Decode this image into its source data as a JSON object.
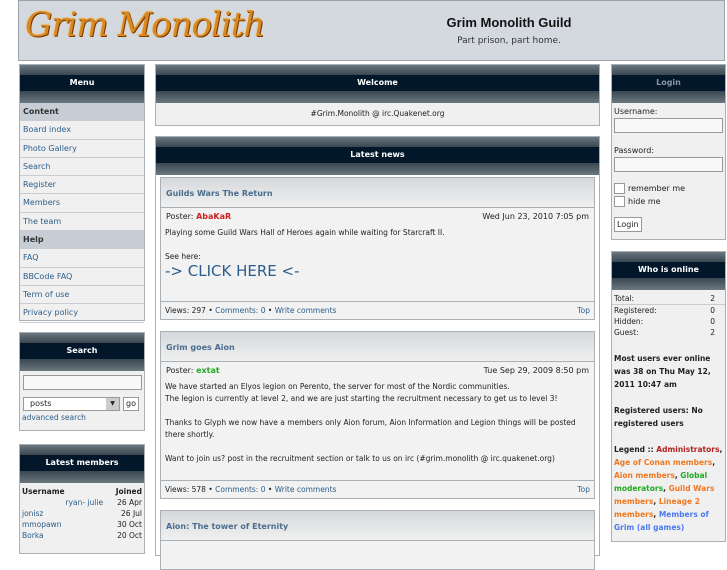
{
  "header": {
    "logo_text": "Grim Monolith",
    "title": "Grim Monolith Guild",
    "description": "Part prison, part home."
  },
  "menu": {
    "title": "Menu",
    "items": [
      {
        "label": "Content",
        "type": "heading"
      },
      {
        "label": "Board index"
      },
      {
        "label": "Photo Gallery"
      },
      {
        "label": "Search"
      },
      {
        "label": "Register"
      },
      {
        "label": "Members"
      },
      {
        "label": "The team"
      },
      {
        "label": "Help",
        "type": "heading"
      },
      {
        "label": "FAQ"
      },
      {
        "label": "BBCode FAQ"
      },
      {
        "label": "Term of use"
      },
      {
        "label": "Privacy policy"
      }
    ]
  },
  "search": {
    "title": "Search",
    "query": "",
    "scope": "posts",
    "go": "go",
    "advanced": "advanced search"
  },
  "latest_members": {
    "title": "Latest members",
    "headers": [
      "Username",
      "Joined"
    ],
    "rows": [
      [
        "ryan- julie",
        "26 Apr"
      ],
      [
        "jonisz",
        "26 Jul"
      ],
      [
        "mmopawn",
        "30 Oct"
      ],
      [
        "Borka",
        "20 Oct"
      ]
    ]
  },
  "welcome": {
    "title": "Welcome",
    "text": "#Grim.Monolith @ irc.Quakenet.org"
  },
  "news": {
    "title": "Latest news",
    "posts": [
      {
        "title": "Guilds Wars The Return",
        "poster_label": "Poster:",
        "poster": "AbaKaR",
        "poster_color": "#cc2222",
        "date": "Wed Jun 23, 2010 7:05 pm",
        "body": [
          "Playing some Guild Wars Hall of Heroes again while waiting for Starcraft II.",
          "",
          "See here:"
        ],
        "big_link": "-> CLICK HERE <-",
        "views": "Views: 297",
        "comments": "Comments: 0",
        "write": "Write comments",
        "top": "Top"
      },
      {
        "title": "Grim goes Aion",
        "poster_label": "Poster:",
        "poster": "extat",
        "poster_color": "#22aa22",
        "date": "Tue Sep 29, 2009 8:50 pm",
        "body": [
          "We have started an Elyos legion on Perento, the server for most of the Nordic communities.",
          "The legion is currently at level 2, and we are just starting the recruitment necessary to get us to level 3!",
          "",
          "Thanks to Glyph we now have a members only Aion forum, Aion Information and Legion things will be posted there shortly.",
          "",
          "Want to join us? post in the recruitment section or talk to us on irc (#grim.monolith @ irc.quakenet.org)"
        ],
        "views": "Views: 578",
        "comments": "Comments: 0",
        "write": "Write comments",
        "top": "Top"
      },
      {
        "title": "Aion: The tower of Eternity"
      }
    ]
  },
  "login": {
    "title": "Login",
    "username_label": "Username:",
    "password_label": "Password:",
    "remember": "remember me",
    "hide": "hide me",
    "button": "Login"
  },
  "online": {
    "title": "Who is online",
    "stats": [
      [
        "Total:",
        "2"
      ],
      [
        "Registered:",
        "0"
      ],
      [
        "Hidden:",
        "0"
      ],
      [
        "Guest:",
        "2"
      ]
    ],
    "record": "Most users ever online was 38 on Thu May 12, 2011 10:47 am",
    "registered": "Registered users: No registered users",
    "legend_label": "Legend ::",
    "legend": [
      {
        "name": "Administrators",
        "color": "#b22222"
      },
      {
        "name": "Age of Conan members",
        "color": "#f07820"
      },
      {
        "name": "Aion members",
        "color": "#f07820"
      },
      {
        "name": "Global moderators",
        "color": "#22aa22"
      },
      {
        "name": "Guild Wars members",
        "color": "#f07820"
      },
      {
        "name": "Lineage 2 members",
        "color": "#f07820"
      },
      {
        "name": "Members of Grim (all games)",
        "color": "#4a7aee"
      }
    ]
  }
}
